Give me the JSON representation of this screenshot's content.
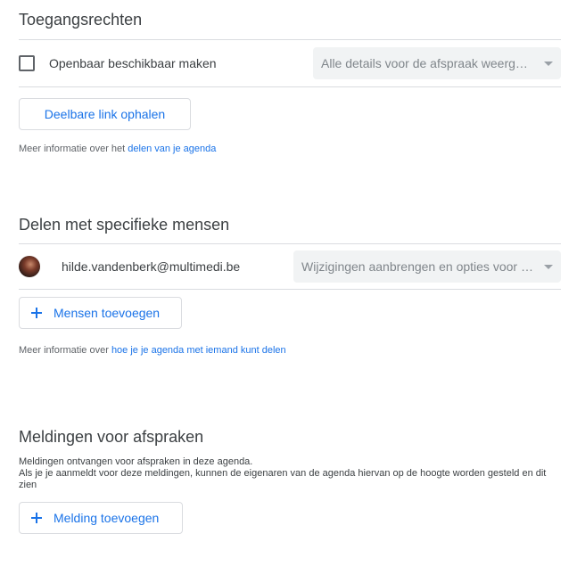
{
  "access": {
    "title": "Toegangsrechten",
    "public_label": "Openbaar beschikbaar maken",
    "public_checked": false,
    "detail_select": "Alle details voor de afspraak weergeven",
    "share_link_button": "Deelbare link ophalen",
    "info_prefix": "Meer informatie over het ",
    "info_link": "delen van je agenda"
  },
  "share": {
    "title": "Delen met specifieke mensen",
    "person_email": "hilde.vandenberk@multimedi.be",
    "permission_select": "Wijzigingen aanbrengen en opties voor delen beheren",
    "add_people_button": "Mensen toevoegen",
    "info_prefix": "Meer informatie over ",
    "info_link": "hoe je je agenda met iemand kunt delen"
  },
  "notifications": {
    "title": "Meldingen voor afspraken",
    "desc_line1": "Meldingen ontvangen voor afspraken in deze agenda.",
    "desc_line2": "Als je je aanmeldt voor deze meldingen, kunnen de eigenaren van de agenda hiervan op de hoogte worden gesteld en dit zien",
    "add_notification_button": "Melding toevoegen"
  },
  "colors": {
    "accent": "#1a73e8",
    "text": "#3c4043",
    "muted": "#5f6368",
    "divider": "#dadce0",
    "select_bg": "#f1f3f4"
  },
  "icons": {
    "checkbox": "checkbox-unchecked-icon",
    "caret": "dropdown-caret-icon",
    "plus": "plus-icon"
  }
}
